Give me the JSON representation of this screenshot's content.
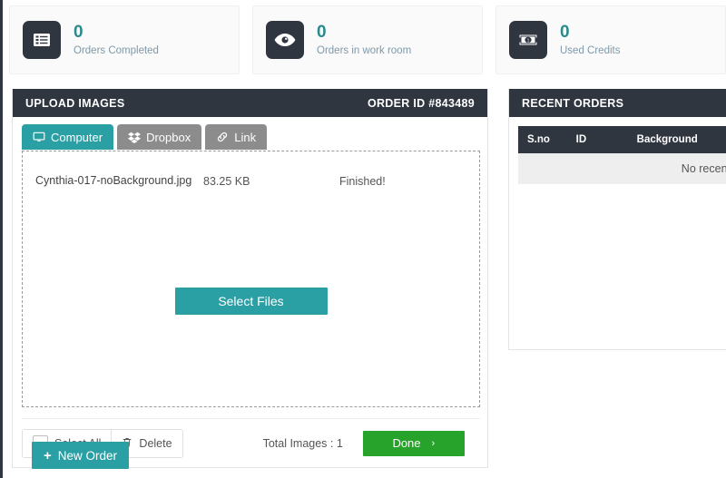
{
  "stats": [
    {
      "icon": "list-icon",
      "value": "0",
      "label": "Orders Completed"
    },
    {
      "icon": "eye-icon",
      "value": "0",
      "label": "Orders in work room"
    },
    {
      "icon": "money-bill-icon",
      "value": "0",
      "label": "Used Credits"
    }
  ],
  "upload_panel": {
    "title": "UPLOAD IMAGES",
    "order_id": "ORDER ID #843489",
    "tabs": [
      {
        "label": "Computer",
        "icon": "desktop-icon",
        "active": true
      },
      {
        "label": "Dropbox",
        "icon": "dropbox-icon",
        "active": false
      },
      {
        "label": "Link",
        "icon": "link-icon",
        "active": false
      }
    ],
    "file": {
      "name": "Cynthia-017-noBackground.jpg",
      "size": "83.25 KB",
      "status": "Finished!"
    },
    "select_files_label": "Select Files",
    "select_all_label": "Select All",
    "delete_label": "Delete",
    "total_images": "Total Images : 1",
    "done_label": "Done",
    "done_chevron": "›",
    "new_order_label": "New Order"
  },
  "recent_orders": {
    "title": "RECENT ORDERS",
    "columns": [
      "S.no",
      "ID",
      "Background"
    ],
    "empty_text": "No recent"
  },
  "colors": {
    "teal": "#2a9fa4",
    "dark": "#2f3640",
    "green": "#27a22b",
    "muted": "#7f98a8"
  }
}
